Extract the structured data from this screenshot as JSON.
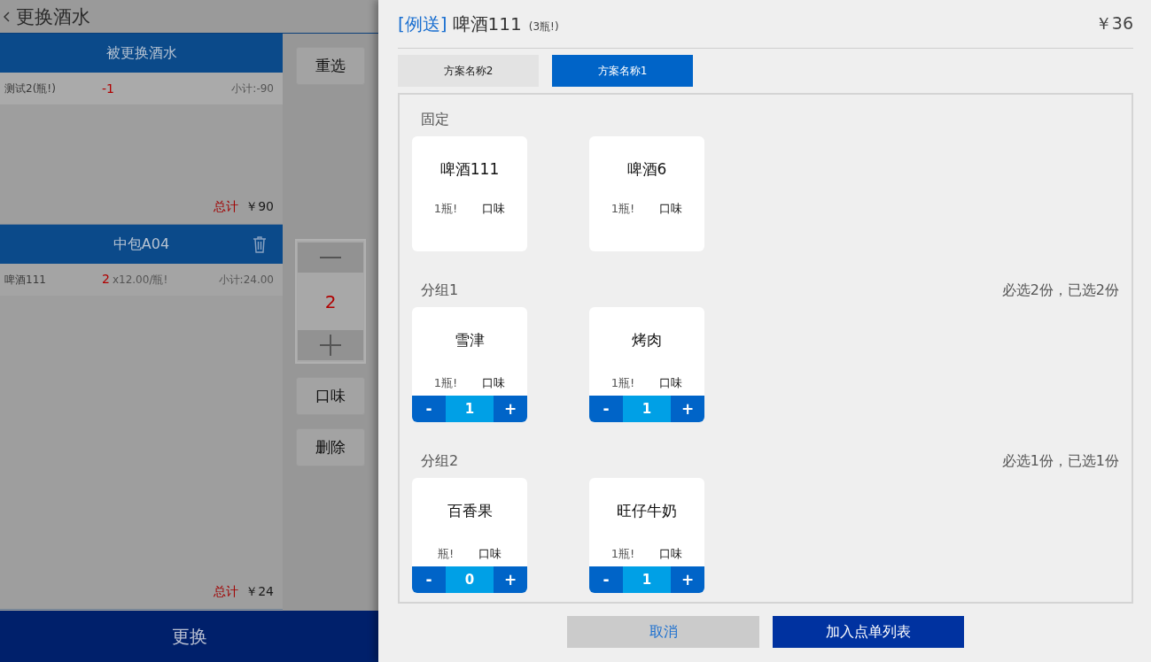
{
  "left": {
    "title": "更换酒水",
    "sections": [
      {
        "title": "被更换酒水",
        "trash": false,
        "rows": [
          {
            "name": "测试2(瓶!)",
            "qty": "-1",
            "subtotal": "小计:-90"
          }
        ],
        "total_label": "总计",
        "total": "￥90"
      },
      {
        "title": "中包A04",
        "trash": true,
        "rows": [
          {
            "name": "啤酒111",
            "qty": "2",
            "unit_price": "x12.00/瓶!",
            "subtotal": "小计:24.00"
          }
        ],
        "total_label": "总计",
        "total": "￥24"
      }
    ],
    "reselect_button": "重选",
    "stepper": {
      "value": "2"
    },
    "flavor_button": "口味",
    "delete_button": "删除",
    "confirm_button": "更换"
  },
  "drawer": {
    "tag": "[例送]",
    "title": "啤酒111",
    "spec": "(3瓶!)",
    "price": "￥36",
    "tabs": [
      {
        "label": "方案名称2",
        "selected": false
      },
      {
        "label": "方案名称1",
        "selected": true
      }
    ],
    "groups": [
      {
        "kind": "fixed",
        "title": "固定",
        "items": [
          {
            "name": "啤酒111",
            "spec": "1瓶!",
            "flavor": "口味"
          },
          {
            "name": "啤酒6",
            "spec": "1瓶!",
            "flavor": "口味"
          }
        ]
      },
      {
        "kind": "choice",
        "title": "分组1",
        "rule": "必选2份，已选2份",
        "items": [
          {
            "name": "雪津",
            "spec": "1瓶!",
            "flavor": "口味",
            "minus": "-",
            "count": "1",
            "plus": "+"
          },
          {
            "name": "烤肉",
            "spec": "1瓶!",
            "flavor": "口味",
            "minus": "-",
            "count": "1",
            "plus": "+"
          }
        ]
      },
      {
        "kind": "choice",
        "title": "分组2",
        "rule": "必选1份，已选1份",
        "items": [
          {
            "name": "百香果",
            "spec": "瓶!",
            "flavor": "口味",
            "minus": "-",
            "count": "0",
            "plus": "+"
          },
          {
            "name": "旺仔牛奶",
            "spec": "1瓶!",
            "flavor": "口味",
            "minus": "-",
            "count": "1",
            "plus": "+"
          }
        ]
      }
    ],
    "cancel_button": "取消",
    "add_button": "加入点单列表"
  }
}
